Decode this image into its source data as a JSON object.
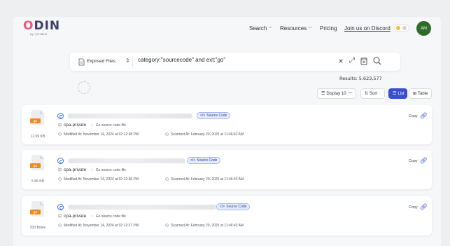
{
  "brand": {
    "logo_text": "ODIN",
    "logo_sub": "by ⬡CYBLE"
  },
  "nav": {
    "search": "Search",
    "resources": "Resources",
    "pricing": "Pricing",
    "discord": "Join us on Discord",
    "avatar": "AM"
  },
  "search": {
    "type_label": "Exposed Files",
    "query": "category:\"sourcecode\" and ext:\"go\""
  },
  "results_label": "Results: 5,623,577",
  "toolbar": {
    "display": "Display 10",
    "sort": "Sort",
    "list": "List",
    "table": "Table"
  },
  "cards": [
    {
      "ext": "go",
      "size": "12.99 KB",
      "badge": "Source Code",
      "repo": "cpa-private",
      "go_source": "Go source code file",
      "modified": "Modified At: November 14, 2024 at 02:12:38 PM",
      "scanned": "Scanned At: February 20, 2025 at 11:46:42 AM",
      "copy": "Copy"
    },
    {
      "ext": "go",
      "size": "5.86 KB",
      "badge": "Source Code",
      "repo": "cpa-private",
      "go_source": "Go source code file",
      "modified": "Modified At: November 14, 2024 at 02:12:38 PM",
      "scanned": "Scanned At: February 20, 2025 at 11:46:42 AM",
      "copy": "Copy"
    },
    {
      "ext": "go",
      "size": "933 Bytes",
      "badge": "Source Code",
      "repo": "cpa-private",
      "go_source": "Go source code file",
      "modified": "Modified At: November 14, 2024 at 02:12:37 PM",
      "scanned": "Scanned At: February 20, 2025 at 11:46:42 AM",
      "copy": "Copy"
    }
  ]
}
